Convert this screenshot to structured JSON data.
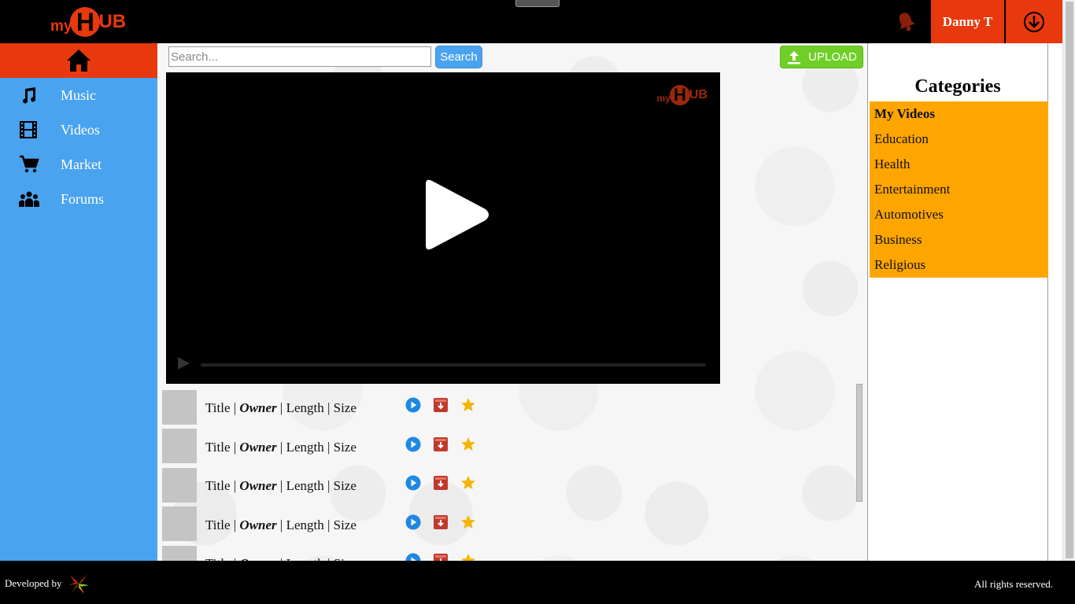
{
  "app": {
    "logo": {
      "my": "my",
      "h": "H",
      "ub": "UB"
    },
    "user_name": "Danny T",
    "colors": {
      "brand": "#e8380d",
      "sidebar": "#4aa3ee",
      "upload": "#6fcf26",
      "categories": "#ffa500"
    }
  },
  "sidebar": {
    "items": [
      {
        "label": "Music",
        "icon": "music-note-icon"
      },
      {
        "label": "Videos",
        "icon": "film-icon"
      },
      {
        "label": "Market",
        "icon": "cart-icon"
      },
      {
        "label": "Forums",
        "icon": "people-icon"
      }
    ]
  },
  "search": {
    "placeholder": "Search...",
    "button_label": "Search"
  },
  "upload": {
    "label": "UPLOAD"
  },
  "player": {
    "logo": {
      "my": "my",
      "h": "H",
      "ub": "UB"
    }
  },
  "videos": {
    "rows": [
      {
        "title": "Title",
        "owner": "Owner",
        "length": "Length",
        "size": "Size"
      },
      {
        "title": "Title",
        "owner": "Owner",
        "length": "Length",
        "size": "Size"
      },
      {
        "title": "Title",
        "owner": "Owner",
        "length": "Length",
        "size": "Size"
      },
      {
        "title": "Title",
        "owner": "Owner",
        "length": "Length",
        "size": "Size"
      },
      {
        "title": "Title",
        "owner": "Owner",
        "length": "Length",
        "size": "Size"
      }
    ],
    "separator": "|"
  },
  "categories": {
    "title": "Categories",
    "items": [
      "My Videos",
      "Education",
      "Health",
      "Entertainment",
      "Automotives",
      "Business",
      "Religious"
    ]
  },
  "footer": {
    "developed_by": "Developed by",
    "rights": "All rights reserved."
  }
}
